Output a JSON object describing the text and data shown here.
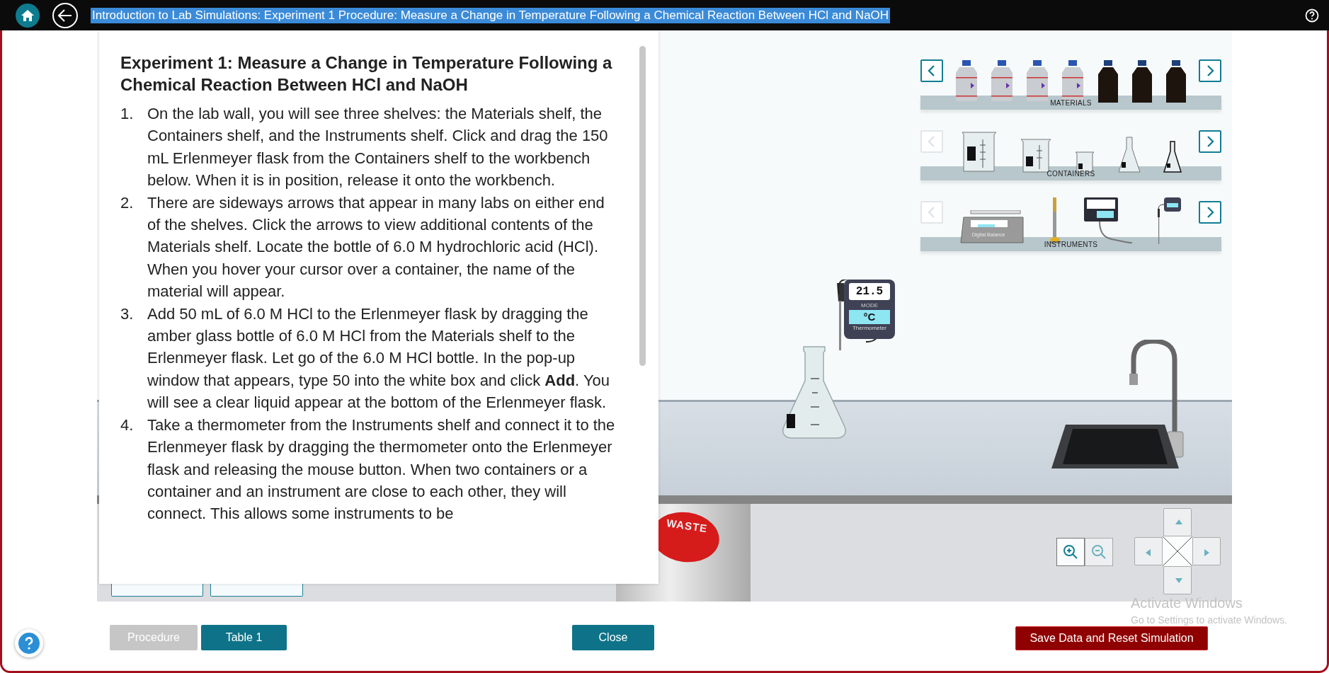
{
  "topbar": {
    "title": "Introduction to Lab Simulations: Experiment 1 Procedure: Measure a Change in Temperature Following a Chemical Reaction Between HCl and NaOH"
  },
  "procedure": {
    "heading": "Experiment 1: Measure a Change in Temperature Following a Chemical Reaction Between HCl and NaOH",
    "steps": [
      {
        "number": "1.",
        "text": "On the lab wall, you will see three shelves: the Materials shelf, the Containers shelf, and the Instruments shelf.  Click and drag the 150 mL Erlenmeyer flask from the Containers shelf to the workbench below. When it is in position, release it onto the workbench."
      },
      {
        "number": "2.",
        "text": "There are sideways arrows that appear in many labs on either end of the shelves. Click the arrows to view additional contents of the Materials shelf. Locate the bottle of 6.0 M hydrochloric acid (HCl). When you hover your cursor over a container, the name of the material will appear."
      },
      {
        "number": "3.",
        "text": "Add 50 mL of 6.0 M HCl to the Erlenmeyer flask by dragging the amber glass bottle of 6.0 M HCl from the Materials shelf to the Erlenmeyer flask. Let go of the 6.0 M HCl bottle. In the pop-up window that appears, type 50 into the white box and click **Add**. You will see a clear liquid appear at the bottom of the Erlenmeyer flask."
      },
      {
        "number": "4.",
        "text": "Take a thermometer from the Instruments shelf and connect it to the Erlenmeyer flask by dragging the thermometer onto the Erlenmeyer flask and releasing the mouse button. When two containers or a container and an instrument are close to each other, they will connect. This allows some instruments to be"
      }
    ]
  },
  "shelves": [
    {
      "label": "MATERIALS",
      "left_disabled": false,
      "items": [
        {
          "kind": "bottle-white"
        },
        {
          "kind": "bottle-white"
        },
        {
          "kind": "bottle-white"
        },
        {
          "kind": "bottle-white"
        },
        {
          "kind": "bottle-amber"
        },
        {
          "kind": "bottle-amber"
        },
        {
          "kind": "bottle-amber"
        }
      ]
    },
    {
      "label": "CONTAINERS",
      "left_disabled": true,
      "items": [
        {
          "kind": "beaker-large"
        },
        {
          "kind": "beaker-medium"
        },
        {
          "kind": "beaker-small"
        },
        {
          "kind": "flask-large"
        },
        {
          "kind": "flask-small"
        }
      ]
    },
    {
      "label": "INSTRUMENTS",
      "left_disabled": true,
      "items": [
        {
          "kind": "balance",
          "label": "Digital Balance"
        },
        {
          "kind": "burner"
        },
        {
          "kind": "meter"
        },
        {
          "kind": "thermometer"
        }
      ]
    }
  ],
  "thermometer": {
    "reading": "21.5",
    "mode_label": "MODE",
    "unit": "°C",
    "name": "Thermometer"
  },
  "waste": {
    "label": "WASTE"
  },
  "tabs": [
    {
      "label": "Procedure",
      "selected": true
    },
    {
      "label": "Table 1",
      "selected": false
    }
  ],
  "close_button": "Close",
  "save_button": "Save Data and Reset Simulation",
  "os_notice": {
    "title": "Activate Windows",
    "subtitle": "Go to Settings to activate Windows."
  }
}
